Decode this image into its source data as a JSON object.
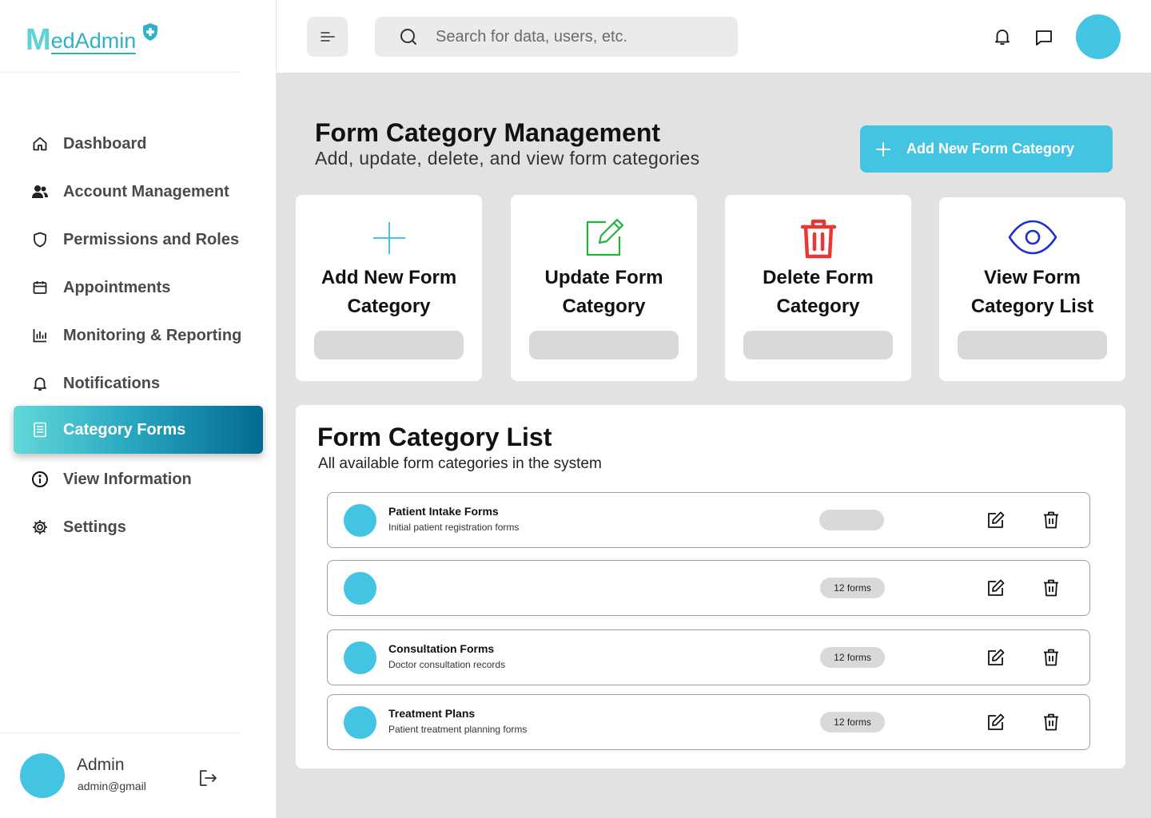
{
  "app": {
    "logo_initial": "M",
    "logo_rest": "edAdmin"
  },
  "sidebar": {
    "items": [
      {
        "label": "Dashboard",
        "icon": "home-icon"
      },
      {
        "label": "Account Management",
        "icon": "users-icon"
      },
      {
        "label": "Permissions and Roles",
        "icon": "shield-icon"
      },
      {
        "label": "Appointments",
        "icon": "calendar-icon"
      },
      {
        "label": "Monitoring & Reporting",
        "icon": "bar-chart-icon"
      },
      {
        "label": "Notifications",
        "icon": "bell-icon"
      },
      {
        "label": "Category Forms",
        "icon": "document-icon",
        "active": true
      },
      {
        "label": "View Information",
        "icon": "info-icon"
      },
      {
        "label": "Settings",
        "icon": "gear-icon"
      }
    ],
    "user": {
      "name": "Admin",
      "email": "admin@gmail"
    }
  },
  "topbar": {
    "search_placeholder": "Search for data, users, etc."
  },
  "header": {
    "title": "Form Category Management",
    "subtitle": "Add, update, delete, and view form categories",
    "add_button": "Add New Form Category"
  },
  "cards": [
    {
      "line1": "Add New Form",
      "line2": "Category",
      "icon": "plus-icon"
    },
    {
      "line1": "Update Form",
      "line2": "Category",
      "icon": "edit-icon"
    },
    {
      "line1": "Delete Form",
      "line2": "Category",
      "icon": "trash-icon"
    },
    {
      "line1": "View Form",
      "line2": "Category List",
      "icon": "eye-icon"
    }
  ],
  "list": {
    "title": "Form Category List",
    "subtitle": "All available form categories in the system",
    "rows": [
      {
        "name": "Patient Intake Forms",
        "description": "Initial patient registration forms",
        "count": ""
      },
      {
        "name": "",
        "description": "",
        "count": "12 forms"
      },
      {
        "name": "Consultation Forms",
        "description": "Doctor consultation records",
        "count": "12 forms"
      },
      {
        "name": "Treatment Plans",
        "description": "Patient treatment planning forms",
        "count": "12 forms"
      }
    ]
  },
  "colors": {
    "accent": "#44c4e3",
    "add_icon": "#44c4e3",
    "update_icon": "#22b53a",
    "delete_icon": "#e53935",
    "view_icon": "#1f2ed6"
  }
}
